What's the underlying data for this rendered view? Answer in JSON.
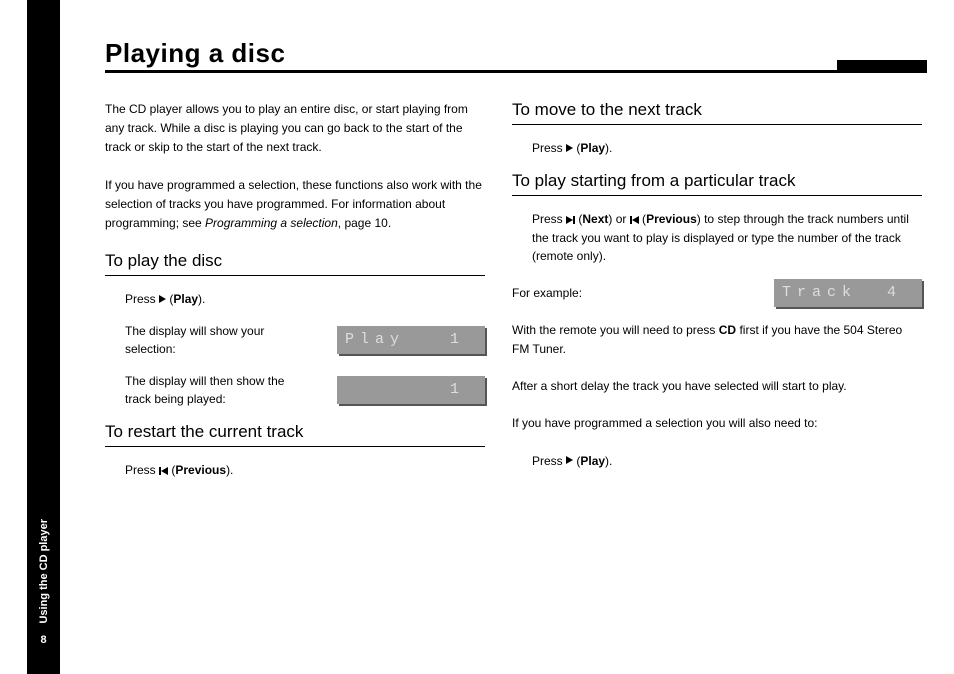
{
  "sidebar": {
    "section_label": "Using the CD player",
    "page_number": "8"
  },
  "title": "Playing a disc",
  "left": {
    "intro1": "The CD player allows you to play an entire disc, or start playing from any track. While a disc is playing you can go back to the start of the track or skip to the start of the next track.",
    "intro2_a": "If you have programmed a selection, these functions also work with the selection of tracks you have programmed. For information about programming; see ",
    "intro2_ref": "Programming a selection",
    "intro2_b": ", page 10.",
    "h_play": "To play the disc",
    "press_play_a": "Press ",
    "press_play_b": " (",
    "press_play_label": "Play",
    "press_play_c": ").",
    "display_show": "The display will show your selection:",
    "lcd_play": "Play   1",
    "display_then": "The display will then show the track being played:",
    "lcd_track1": "       1",
    "h_restart": "To restart the current track",
    "press_prev_a": "Press ",
    "press_prev_b": " (",
    "press_prev_label": "Previous",
    "press_prev_c": ")."
  },
  "right": {
    "h_next": "To move to the next track",
    "press_play2_a": "Press ",
    "press_play2_b": " (",
    "press_play2_label": "Play",
    "press_play2_c": ").",
    "h_particular": "To play starting from a particular track",
    "step_a": "Press ",
    "step_b": " (",
    "step_next_label": "Next",
    "step_c": ") or ",
    "step_d": " (",
    "step_prev_label": "Previous",
    "step_e": ") to step through the track numbers until the track you want to play is displayed or type the number of the track (remote only).",
    "for_example": "For example:",
    "lcd_track4": "Track  4",
    "remote_a": "With the remote you will need to press ",
    "remote_cd": "CD",
    "remote_b": " first if you have the 504 Stereo FM Tuner.",
    "delay": "After a short delay the track you have selected will start to play.",
    "programmed": "If you have programmed a selection you will also need to:",
    "press_play3_a": "Press ",
    "press_play3_b": " (",
    "press_play3_label": "Play",
    "press_play3_c": ")."
  }
}
